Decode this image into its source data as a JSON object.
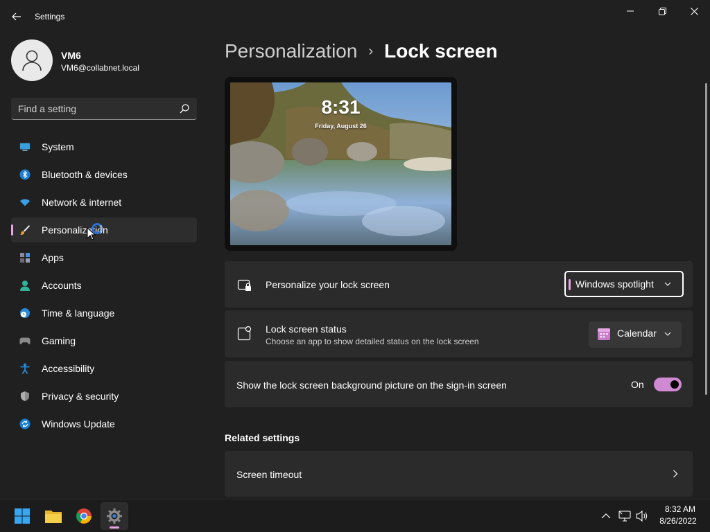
{
  "window": {
    "title": "Settings"
  },
  "profile": {
    "name": "VM6",
    "email": "VM6@collabnet.local"
  },
  "search": {
    "placeholder": "Find a setting"
  },
  "nav": {
    "items": [
      {
        "label": "System",
        "icon": "system-icon"
      },
      {
        "label": "Bluetooth & devices",
        "icon": "bluetooth-icon"
      },
      {
        "label": "Network & internet",
        "icon": "wifi-icon"
      },
      {
        "label": "Personalization",
        "icon": "brush-icon",
        "active": true
      },
      {
        "label": "Apps",
        "icon": "apps-icon"
      },
      {
        "label": "Accounts",
        "icon": "accounts-icon"
      },
      {
        "label": "Time & language",
        "icon": "clock-globe-icon"
      },
      {
        "label": "Gaming",
        "icon": "gamepad-icon"
      },
      {
        "label": "Accessibility",
        "icon": "accessibility-icon"
      },
      {
        "label": "Privacy & security",
        "icon": "shield-icon"
      },
      {
        "label": "Windows Update",
        "icon": "update-icon"
      }
    ]
  },
  "breadcrumb": {
    "parent": "Personalization",
    "separator": "›",
    "current": "Lock screen"
  },
  "preview": {
    "time": "8:31",
    "date": "Friday, August 26"
  },
  "settings": {
    "personalize": {
      "title": "Personalize your lock screen",
      "value": "Windows spotlight"
    },
    "status": {
      "title": "Lock screen status",
      "subtitle": "Choose an app to show detailed status on the lock screen",
      "value": "Calendar"
    },
    "signin_bg": {
      "title": "Show the lock screen background picture on the sign-in screen",
      "state": "On",
      "enabled": true
    }
  },
  "related": {
    "title": "Related settings",
    "items": [
      {
        "label": "Screen timeout"
      }
    ]
  },
  "taskbar": {
    "clock_time": "8:32 AM",
    "clock_date": "8/26/2022"
  },
  "colors": {
    "accent": "#e8a4e6",
    "toggle_on": "#d08ad4",
    "background": "#202020",
    "card": "#2b2b2b"
  }
}
